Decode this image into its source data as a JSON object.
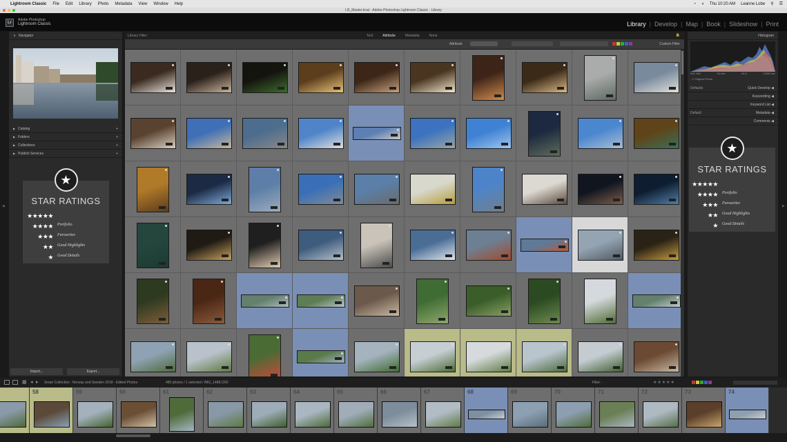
{
  "menubar": {
    "app_name": "Lightroom Classic",
    "items": [
      "File",
      "Edit",
      "Library",
      "Photo",
      "Metadata",
      "View",
      "Window",
      "Help"
    ],
    "clock": "Thu 10:20 AM",
    "user": "Leanne Lobe"
  },
  "window": {
    "title": "LR_Master.lrcat - Adobe Photoshop Lightroom Classic - Library"
  },
  "identity": {
    "logo": "Lr",
    "line1": "Adobe Photoshop",
    "line2": "Lightroom Classic"
  },
  "modules": {
    "items": [
      "Library",
      "Develop",
      "Map",
      "Book",
      "Slideshow",
      "Print"
    ],
    "active": "Library"
  },
  "left_panel": {
    "navigator_label": "Navigator",
    "sections": [
      "Catalog",
      "Folders",
      "Collections",
      "Publish Services"
    ],
    "import_label": "Import...",
    "export_label": "Export..."
  },
  "grid": {
    "header_left": "Library Filter:",
    "header_tabs": [
      "Text",
      "Attribute",
      "Metadata",
      "None"
    ],
    "filter_left": "Attribute",
    "filter_right": "Custom Filter",
    "rows": [
      [
        {
          "sel": 0,
          "c1": "#3a2a20",
          "c2": "#e9e3da",
          "orient": "land"
        },
        {
          "sel": 0,
          "c1": "#2a211b",
          "c2": "#cbb49c",
          "orient": "land"
        },
        {
          "sel": 0,
          "c1": "#14140f",
          "c2": "#3f6b2c",
          "orient": "land"
        },
        {
          "sel": 0,
          "c1": "#5c3d1c",
          "c2": "#e5c27a",
          "orient": "land"
        },
        {
          "sel": 0,
          "c1": "#3b2617",
          "c2": "#c7a17d",
          "orient": "land"
        },
        {
          "sel": 0,
          "c1": "#4a3520",
          "c2": "#f1e6cc",
          "orient": "land"
        },
        {
          "sel": 0,
          "c1": "#3d2418",
          "c2": "#d08b4b",
          "orient": "port"
        },
        {
          "sel": 0,
          "c1": "#3b2a18",
          "c2": "#d9b886",
          "orient": "land"
        },
        {
          "sel": 0,
          "c1": "#a9acab",
          "c2": "#5e6a62",
          "orient": "port"
        },
        {
          "sel": 0,
          "c1": "#7a8a9d",
          "c2": "#e0e0d8",
          "orient": "land"
        }
      ],
      [
        {
          "sel": 0,
          "c1": "#5a4230",
          "c2": "#d8d0c2",
          "orient": "land"
        },
        {
          "sel": 0,
          "c1": "#3e6fb7",
          "c2": "#c6b79b",
          "orient": "land"
        },
        {
          "sel": 0,
          "c1": "#4d6d8e",
          "c2": "#888",
          "orient": "land"
        },
        {
          "sel": 0,
          "c1": "#4f84c9",
          "c2": "#dedede",
          "orient": "land"
        },
        {
          "sel": 1,
          "c1": "#5d7fb2",
          "c2": "#c8c9c3",
          "orient": "pano"
        },
        {
          "sel": 0,
          "c1": "#3c72c0",
          "c2": "#99a6a3",
          "orient": "land"
        },
        {
          "sel": 0,
          "c1": "#3f82d3",
          "c2": "#9ec5ef",
          "orient": "land"
        },
        {
          "sel": 0,
          "c1": "#1c2940",
          "c2": "#5e6b5a",
          "orient": "port"
        },
        {
          "sel": 0,
          "c1": "#4b87cf",
          "c2": "#a9bed4",
          "orient": "land"
        },
        {
          "sel": 0,
          "c1": "#5f4419",
          "c2": "#3b6f57",
          "orient": "land"
        }
      ],
      [
        {
          "sel": 0,
          "c1": "#b07a29",
          "c2": "#5c3c1c",
          "orient": "port"
        },
        {
          "sel": 0,
          "c1": "#1c2a44",
          "c2": "#7ea9d8",
          "orient": "land"
        },
        {
          "sel": 0,
          "c1": "#5d7ea8",
          "c2": "#9baabb",
          "orient": "port"
        },
        {
          "sel": 0,
          "c1": "#3a6fb8",
          "c2": "#7f8b93",
          "orient": "land"
        },
        {
          "sel": 0,
          "c1": "#5a7fa8",
          "c2": "#6b6b6b",
          "orient": "land"
        },
        {
          "sel": 0,
          "c1": "#d8d8cc",
          "c2": "#b59d3c",
          "orient": "land"
        },
        {
          "sel": 0,
          "c1": "#4d84c9",
          "c2": "#6f7f8b",
          "orient": "port"
        },
        {
          "sel": 0,
          "c1": "#dcd9d2",
          "c2": "#5a4a3a",
          "orient": "land"
        },
        {
          "sel": 0,
          "c1": "#101520",
          "c2": "#7b5d49",
          "orient": "land"
        },
        {
          "sel": 0,
          "c1": "#0e1d2f",
          "c2": "#4f7ea7",
          "orient": "land"
        }
      ],
      [
        {
          "sel": 0,
          "c1": "#24463d",
          "c2": "#1c3a33",
          "orient": "port"
        },
        {
          "sel": 0,
          "c1": "#1f1a14",
          "c2": "#c8a05e",
          "orient": "land"
        },
        {
          "sel": 0,
          "c1": "#1f1f1f",
          "c2": "#e2cbb0",
          "orient": "port"
        },
        {
          "sel": 0,
          "c1": "#3e5c7e",
          "c2": "#b5bfc9",
          "orient": "land"
        },
        {
          "sel": 0,
          "c1": "#c9c3b9",
          "c2": "#4b4b4b",
          "orient": "port"
        },
        {
          "sel": 0,
          "c1": "#4a6d96",
          "c2": "#dfe5ec",
          "orient": "land"
        },
        {
          "sel": 0,
          "c1": "#6d7f92",
          "c2": "#a34a2c",
          "orient": "land"
        },
        {
          "sel": 1,
          "c1": "#5f7996",
          "c2": "#b65a38",
          "orient": "pano"
        },
        {
          "sel": 2,
          "c1": "#95a4b3",
          "c2": "#4f5a63",
          "orient": "land"
        },
        {
          "sel": 0,
          "c1": "#2b2216",
          "c2": "#c49b3e",
          "orient": "land"
        }
      ],
      [
        {
          "sel": 0,
          "c1": "#2e3a1f",
          "c2": "#7e5d3a",
          "orient": "port"
        },
        {
          "sel": 0,
          "c1": "#4a2615",
          "c2": "#8b5a3a",
          "orient": "port"
        },
        {
          "sel": 1,
          "c1": "#62806c",
          "c2": "#aeb9c2",
          "orient": "pano"
        },
        {
          "sel": 1,
          "c1": "#5d7d55",
          "c2": "#b7c2c9",
          "orient": "pano"
        },
        {
          "sel": 0,
          "c1": "#6b5a4b",
          "c2": "#c9b8a2",
          "orient": "land"
        },
        {
          "sel": 0,
          "c1": "#3f6c33",
          "c2": "#8fa86b",
          "orient": "port"
        },
        {
          "sel": 0,
          "c1": "#3a5d2a",
          "c2": "#89a064",
          "orient": "land"
        },
        {
          "sel": 0,
          "c1": "#2c4a22",
          "c2": "#6c8b4e",
          "orient": "port"
        },
        {
          "sel": 0,
          "c1": "#d5d9dd",
          "c2": "#4e6b34",
          "orient": "port"
        },
        {
          "sel": 1,
          "c1": "#62806c",
          "c2": "#c0c9cf",
          "orient": "pano"
        }
      ],
      [
        {
          "sel": 0,
          "c1": "#8fa2b3",
          "c2": "#4d6b3c",
          "orient": "land"
        },
        {
          "sel": 0,
          "c1": "#b9c2ca",
          "c2": "#5d7a3f",
          "orient": "land"
        },
        {
          "sel": 0,
          "c1": "#4a6b34",
          "c2": "#c84a3b",
          "orient": "port"
        },
        {
          "sel": 1,
          "c1": "#5a7a4a",
          "c2": "#9bb0c0",
          "orient": "pano"
        },
        {
          "sel": 0,
          "c1": "#a5b3bf",
          "c2": "#3f6b2f",
          "orient": "land"
        },
        {
          "sel": 3,
          "c1": "#c7ced3",
          "c2": "#4b6d36",
          "orient": "land"
        },
        {
          "sel": 3,
          "c1": "#d6dadc",
          "c2": "#5e7b43",
          "orient": "land"
        },
        {
          "sel": 3,
          "c1": "#b9c5cd",
          "c2": "#4c6a3b",
          "orient": "land"
        },
        {
          "sel": 0,
          "c1": "#c4ccd2",
          "c2": "#3f5f2e",
          "orient": "land"
        },
        {
          "sel": 0,
          "c1": "#6b4a33",
          "c2": "#c7b7a0",
          "orient": "land"
        }
      ]
    ]
  },
  "right_panel": {
    "histogram_label": "Histogram",
    "histogram_stats": [
      "ISO 160",
      "24 mm",
      "f/4.0",
      "1/250 sec"
    ],
    "original_photo": "Original Photo",
    "sections": [
      "Quick Develop",
      "Keywording",
      "Keyword List",
      "Metadata",
      "Comments"
    ],
    "quick_left": "Defaults",
    "metadata_left": "Default"
  },
  "star_card": {
    "title": "STAR RATINGS",
    "rows": [
      {
        "stars": "★★★★★",
        "label": ""
      },
      {
        "stars": "★★★★",
        "label": "Portfolio"
      },
      {
        "stars": "★★★",
        "label": "Favourites"
      },
      {
        "stars": "★★",
        "label": "Good Highlights"
      },
      {
        "stars": "★",
        "label": "Good Details"
      }
    ]
  },
  "bottombar": {
    "path": "Smart Collection : Norway and Sweden 2018 - Edited Photos",
    "count": "480 photos / 1 selected / IMG_1488.CR2",
    "filter_label": "Filter :"
  },
  "filmstrip": {
    "numbers": [
      "58",
      "59",
      "60",
      "61",
      "62",
      "63",
      "64",
      "65",
      "66",
      "67",
      "68",
      "69",
      "70",
      "71",
      "72",
      "73",
      "74"
    ],
    "frames": [
      {
        "sel": 3,
        "c1": "#8a9aa8",
        "c2": "#4f6a3a",
        "orient": "land"
      },
      {
        "sel": 3,
        "c1": "#5b4a3a",
        "c2": "#88a0b5",
        "orient": "land"
      },
      {
        "sel": 0,
        "c1": "#a4b1bd",
        "c2": "#45632f",
        "orient": "land"
      },
      {
        "sel": 0,
        "c1": "#6a4f35",
        "c2": "#d2c0a6",
        "orient": "land"
      },
      {
        "sel": 0,
        "c1": "#4f6b3a",
        "c2": "#a6b5c1",
        "orient": "port"
      },
      {
        "sel": 0,
        "c1": "#8898a6",
        "c2": "#5d7a43",
        "orient": "land"
      },
      {
        "sel": 0,
        "c1": "#9eacb7",
        "c2": "#3f5f2f",
        "orient": "land"
      },
      {
        "sel": 0,
        "c1": "#aab6c0",
        "c2": "#4b6a39",
        "orient": "land"
      },
      {
        "sel": 0,
        "c1": "#a0adb9",
        "c2": "#506d3c",
        "orient": "land"
      },
      {
        "sel": 0,
        "c1": "#7d8d9b",
        "c2": "#b6c1c9",
        "orient": "land"
      },
      {
        "sel": 0,
        "c1": "#b1bcc5",
        "c2": "#5f7b47",
        "orient": "land"
      },
      {
        "sel": 1,
        "c1": "#7c8fa3",
        "c2": "#c4ccd3",
        "orient": "pano"
      },
      {
        "sel": 0,
        "c1": "#8da0b1",
        "c2": "#5a6c7c",
        "orient": "land"
      },
      {
        "sel": 0,
        "c1": "#8c9eaf",
        "c2": "#4f6b3a",
        "orient": "land"
      },
      {
        "sel": 0,
        "c1": "#6b7f56",
        "c2": "#a9b7c2",
        "orient": "land"
      },
      {
        "sel": 0,
        "c1": "#aeb9c2",
        "c2": "#56704a",
        "orient": "land"
      },
      {
        "sel": 0,
        "c1": "#5a3f2a",
        "c2": "#c8a36b",
        "orient": "land"
      },
      {
        "sel": 1,
        "c1": "#8e9faf",
        "c2": "#c5ccd2",
        "orient": "pano"
      }
    ]
  }
}
